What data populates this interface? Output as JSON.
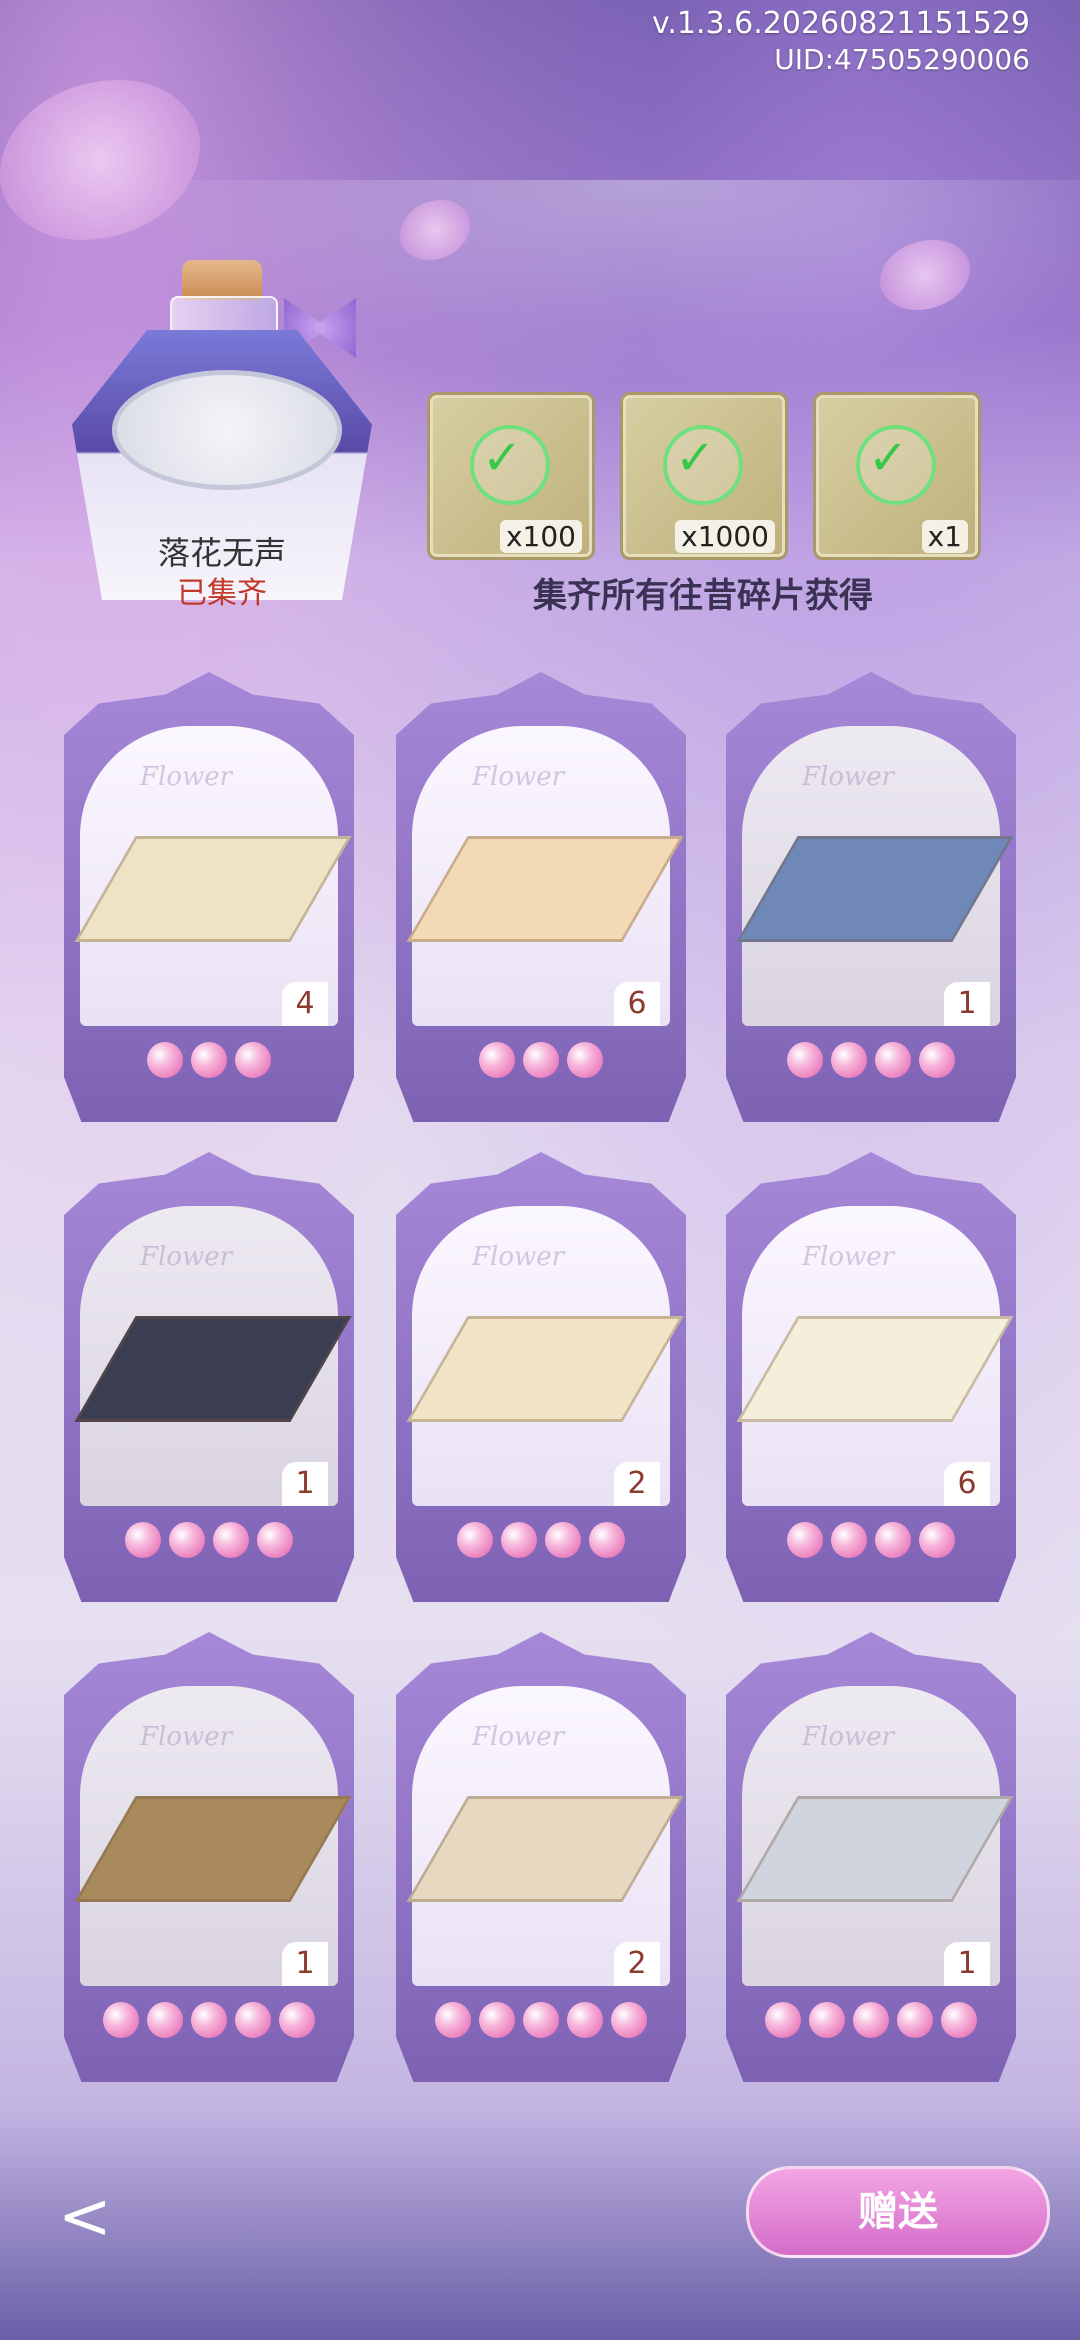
{
  "header": {
    "version": "v.1.3.6.20260821151529",
    "uid": "UID:47505290006"
  },
  "collection": {
    "name": "落花无声",
    "status": "已集齐"
  },
  "rewards": {
    "items": [
      {
        "icon": "feather-quill-icon",
        "qty": "x100"
      },
      {
        "icon": "gold-coin-icon",
        "qty": "x1000"
      },
      {
        "icon": "fire-bird-icon",
        "qty": "x1"
      }
    ],
    "caption": "集齐所有往昔碎片获得"
  },
  "cards": [
    {
      "count": "4",
      "stars": 3,
      "rug_color": "#efe3c6",
      "dim": false
    },
    {
      "count": "6",
      "stars": 3,
      "rug_color": "#f3d9b5",
      "dim": false
    },
    {
      "count": "1",
      "stars": 4,
      "rug_color": "#6f88b8",
      "dim": true
    },
    {
      "count": "1",
      "stars": 4,
      "rug_color": "#3b3d52",
      "dim": true
    },
    {
      "count": "2",
      "stars": 4,
      "rug_color": "#f1e4c6",
      "dim": false
    },
    {
      "count": "6",
      "stars": 4,
      "rug_color": "#f3efda",
      "dim": false
    },
    {
      "count": "1",
      "stars": 5,
      "rug_color": "#a88a5c",
      "dim": true
    },
    {
      "count": "2",
      "stars": 5,
      "rug_color": "#e7d8c2",
      "dim": false
    },
    {
      "count": "1",
      "stars": 5,
      "rug_color": "#cfd4de",
      "dim": true
    }
  ],
  "buttons": {
    "gift": "赠送",
    "back": "<"
  }
}
